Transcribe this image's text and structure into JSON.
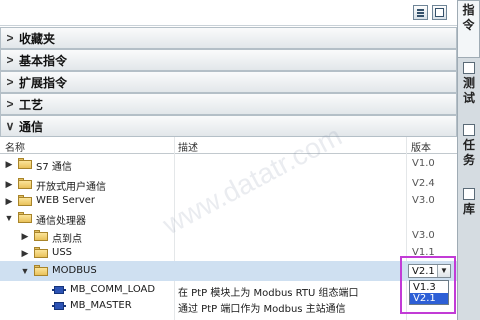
{
  "toolbar": {
    "buttons": [
      "list-view-icon",
      "window-icon"
    ]
  },
  "sections": [
    {
      "title": "收藏夹",
      "state": "collapsed"
    },
    {
      "title": "基本指令",
      "state": "collapsed"
    },
    {
      "title": "扩展指令",
      "state": "collapsed"
    },
    {
      "title": "工艺",
      "state": "collapsed"
    },
    {
      "title": "通信",
      "state": "expanded"
    }
  ],
  "columns": {
    "name": "名称",
    "desc": "描述",
    "version": "版本"
  },
  "rows": [
    {
      "expander": "▶",
      "icon": "folder-icon",
      "name": "S7 通信",
      "desc": "",
      "version": "V1.0"
    },
    {
      "expander": "▶",
      "icon": "folder-icon",
      "name": "开放式用户通信",
      "desc": "",
      "version": "V2.4"
    },
    {
      "expander": "▶",
      "icon": "folder-icon",
      "name": "WEB Server",
      "desc": "",
      "version": "V3.0"
    },
    {
      "expander": "▼",
      "icon": "folder-icon",
      "name": "通信处理器",
      "desc": "",
      "version": ""
    },
    {
      "expander": "▶",
      "icon": "folder-icon",
      "name": "点到点",
      "desc": "",
      "version": "V3.0"
    },
    {
      "expander": "▶",
      "icon": "folder-icon",
      "name": "USS",
      "desc": "",
      "version": "V1.1"
    },
    {
      "expander": "▼",
      "icon": "folder-icon",
      "name": "MODBUS",
      "desc": "",
      "version": "V2.1"
    },
    {
      "expander": "",
      "icon": "block-icon",
      "name": "MB_COMM_LOAD",
      "desc": "在 PtP 模块上为 Modbus RTU 组态端口",
      "version": ""
    },
    {
      "expander": "",
      "icon": "block-icon",
      "name": "MB_MASTER",
      "desc": "通过 PtP 端口作为 Modbus 主站通信",
      "version": ""
    }
  ],
  "version_select": {
    "value": "V2.1",
    "arrow": "▼",
    "options": [
      "V1.3",
      "V2.1"
    ],
    "highlighted": "V2.1"
  },
  "watermark": "www.datatr.com",
  "side_tabs": [
    {
      "label": "指令",
      "icon": "instructions-icon",
      "active": true
    },
    {
      "label": "测试",
      "icon": "test-icon",
      "active": false
    },
    {
      "label": "任务",
      "icon": "tasks-icon",
      "active": false
    },
    {
      "label": "库",
      "icon": "library-icon",
      "active": false
    }
  ],
  "colors": {
    "accent_blue": "#2d5fd6",
    "highlight_magenta": "#c23bd6",
    "selection": "#cfe0f1"
  }
}
